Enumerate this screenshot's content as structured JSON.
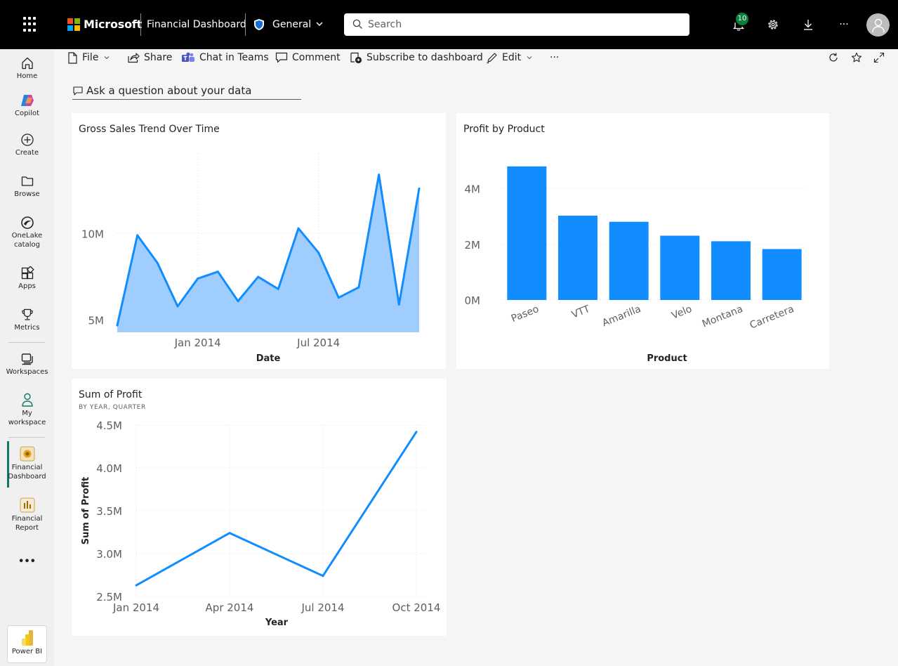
{
  "topbar": {
    "brand": "Microsoft",
    "dashboard_name": "Financial Dashboard",
    "sensitivity_label": "General",
    "search_placeholder": "Search",
    "notifications_count": "10",
    "more_label": "···",
    "brand_colors": [
      "#f25022",
      "#7fba00",
      "#00a4ef",
      "#ffb900"
    ]
  },
  "rail": {
    "items": [
      {
        "label": "Home",
        "icon": "home-icon"
      },
      {
        "label": "Copilot",
        "icon": "copilot-icon"
      },
      {
        "label": "Create",
        "icon": "create-icon"
      },
      {
        "label": "Browse",
        "icon": "folder-icon"
      },
      {
        "label_line1": "OneLake",
        "label_line2": "catalog",
        "icon": "onelake-icon"
      },
      {
        "label": "Apps",
        "icon": "apps-icon"
      },
      {
        "label": "Metrics",
        "icon": "trophy-icon"
      },
      {
        "label": "Workspaces",
        "icon": "workspaces-icon"
      },
      {
        "label_line1": "My",
        "label_line2": "workspace",
        "icon": "person-icon"
      },
      {
        "label_line1": "Financial",
        "label_line2": "Dashboard",
        "icon": "dashboard-icon"
      },
      {
        "label_line1": "Financial",
        "label_line2": "Report",
        "icon": "report-icon"
      }
    ],
    "more_label": "•••",
    "app_label": "Power BI"
  },
  "toolbar": {
    "file": "File",
    "share": "Share",
    "chat": "Chat in Teams",
    "comment": "Comment",
    "subscribe": "Subscribe to dashboard",
    "edit": "Edit",
    "more": "···"
  },
  "qa_prompt": "Ask a question about your data",
  "tiles": {
    "gross": {
      "title": "Gross Sales Trend Over Time"
    },
    "profit_product": {
      "title": "Profit by Product"
    },
    "sum_profit": {
      "title": "Sum of Profit",
      "subtitle": "BY YEAR, QUARTER"
    }
  },
  "chart_data": [
    {
      "type": "area",
      "title": "Gross Sales Trend Over Time",
      "xlabel": "Date",
      "ylabel": "",
      "x_ticks": [
        "Jan 2014",
        "Jul 2014"
      ],
      "y_ticks": [
        "5M",
        "10M"
      ],
      "ylim": [
        4.3,
        14.6
      ],
      "x": [
        "2013-09",
        "2013-10",
        "2013-11",
        "2013-12",
        "2014-01",
        "2014-02",
        "2014-03",
        "2014-04",
        "2014-05",
        "2014-06",
        "2014-07",
        "2014-08",
        "2014-09",
        "2014-10",
        "2014-11",
        "2014-12"
      ],
      "values": [
        4.7,
        9.9,
        8.3,
        5.8,
        7.4,
        7.8,
        6.1,
        7.5,
        6.8,
        10.3,
        8.9,
        6.3,
        6.9,
        13.4,
        5.9,
        12.6
      ],
      "color": "#118dff",
      "fill": "#9fcdfd"
    },
    {
      "type": "bar",
      "title": "Profit by Product",
      "xlabel": "Product",
      "ylabel": "",
      "categories": [
        "Paseo",
        "VTT",
        "Amarilla",
        "Velo",
        "Montana",
        "Carretera"
      ],
      "values": [
        4.8,
        3.03,
        2.81,
        2.31,
        2.11,
        1.83
      ],
      "y_ticks": [
        "0M",
        "2M",
        "4M"
      ],
      "ylim": [
        0,
        5.2
      ],
      "color": "#118dff"
    },
    {
      "type": "line",
      "title": "Sum of Profit",
      "subtitle": "BY YEAR, QUARTER",
      "xlabel": "Year",
      "ylabel": "Sum of Profit",
      "categories": [
        "Jan 2014",
        "Apr 2014",
        "Jul 2014",
        "Oct 2014"
      ],
      "values": [
        2.63,
        3.24,
        2.74,
        4.42
      ],
      "y_ticks": [
        "2.5M",
        "3.0M",
        "3.5M",
        "4.0M",
        "4.5M"
      ],
      "ylim": [
        2.5,
        4.5
      ],
      "color": "#118dff"
    }
  ]
}
